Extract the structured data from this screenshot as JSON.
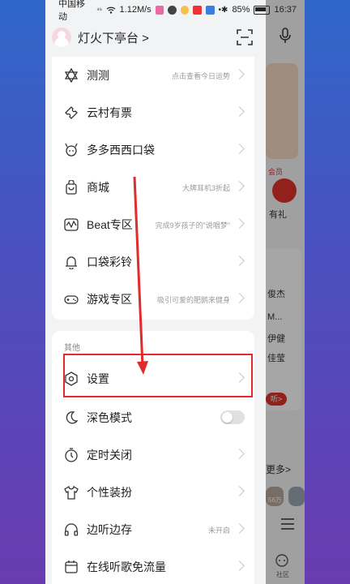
{
  "status_bar": {
    "carrier": "中国移动",
    "signal": "⁴⁶",
    "speed": "1.12M/s",
    "battery": "85%",
    "time": "16:37"
  },
  "drawer": {
    "username": "灯火下亭台 >",
    "menu_top": [
      {
        "label": "测测",
        "hint": "点击查看今日运势",
        "icon": "star-of-david-icon"
      },
      {
        "label": "云村有票",
        "hint": "",
        "icon": "ticket-icon"
      },
      {
        "label": "多多西西口袋",
        "hint": "",
        "icon": "creature-icon"
      },
      {
        "label": "商城",
        "hint": "大牌耳机3折起",
        "icon": "shopping-bag-icon"
      },
      {
        "label": "Beat专区",
        "hint": "完成9岁孩子的\"说唱梦\"",
        "icon": "waveform-icon"
      },
      {
        "label": "口袋彩铃",
        "hint": "",
        "icon": "bell-icon"
      },
      {
        "label": "游戏专区",
        "hint": "吸引可爱的肥鹅来健身",
        "icon": "gamepad-icon"
      }
    ],
    "section_title": "其他",
    "menu_other": [
      {
        "label": "设置",
        "hint": "",
        "icon": "hexagon-settings-icon"
      },
      {
        "label": "深色模式",
        "hint": "",
        "icon": "moon-icon",
        "toggle": false
      },
      {
        "label": "定时关闭",
        "hint": "",
        "icon": "timer-icon"
      },
      {
        "label": "个性装扮",
        "hint": "",
        "icon": "tshirt-icon"
      },
      {
        "label": "边听边存",
        "hint": "未开启",
        "icon": "headphones-icon"
      },
      {
        "label": "在线听歌免流量",
        "hint": "",
        "icon": "calendar-icon"
      }
    ]
  },
  "background": {
    "vip_tag": "会员",
    "gift_text": "有礼",
    "side_texts": [
      "俊杰",
      "M...",
      "伊健",
      "佳莹"
    ],
    "more_link": "更多>",
    "button_text": "听>",
    "count_tag": "56万",
    "community_label": "社区"
  },
  "colors": {
    "highlight": "#e22b2b",
    "accent_red": "#e0332f"
  }
}
